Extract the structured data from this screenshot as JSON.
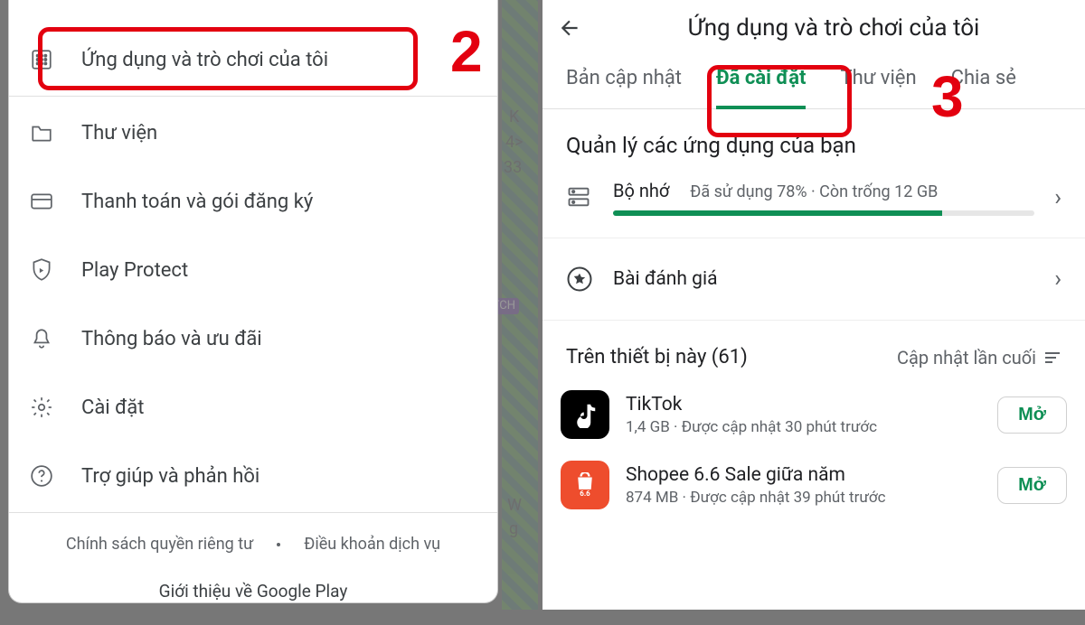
{
  "step_labels": {
    "two": "2",
    "three": "3"
  },
  "left": {
    "bg_chars": {
      "a": "K",
      "b": "4>",
      "c": "33",
      "d": "ATCH",
      "e": "W",
      "f": "g"
    },
    "menu": {
      "my_apps": "Ứng dụng và trò chơi của tôi",
      "library": "Thư viện",
      "payment": "Thanh toán và gói đăng ký",
      "play_protect": "Play Protect",
      "notifications": "Thông báo và ưu đãi",
      "settings": "Cài đặt",
      "help": "Trợ giúp và phản hồi"
    },
    "footer": {
      "privacy": "Chính sách quyền riêng tư",
      "tos": "Điều khoản dịch vụ",
      "about": "Giới thiệu về Google Play"
    }
  },
  "right": {
    "title": "Ứng dụng và trò chơi của tôi",
    "tabs": {
      "updates": "Bản cập nhật",
      "installed": "Đã cài đặt",
      "library": "Thư viện",
      "share": "Chia sẻ"
    },
    "manage_title": "Quản lý các ứng dụng của bạn",
    "storage": {
      "label": "Bộ nhớ",
      "detail": "Đã sử dụng 78% · Còn trống 12 GB",
      "percent": 78
    },
    "reviews_label": "Bài đánh giá",
    "device": {
      "heading": "Trên thiết bị này (61)",
      "sort_label": "Cập nhật lần cuối"
    },
    "apps": [
      {
        "name": "TikTok",
        "meta": "1,4 GB · Được cập nhật 30 phút trước",
        "open": "Mở"
      },
      {
        "name": "Shopee 6.6 Sale giữa năm",
        "meta": "874 MB · Được cập nhật 39 phút trước",
        "open": "Mở"
      }
    ]
  }
}
